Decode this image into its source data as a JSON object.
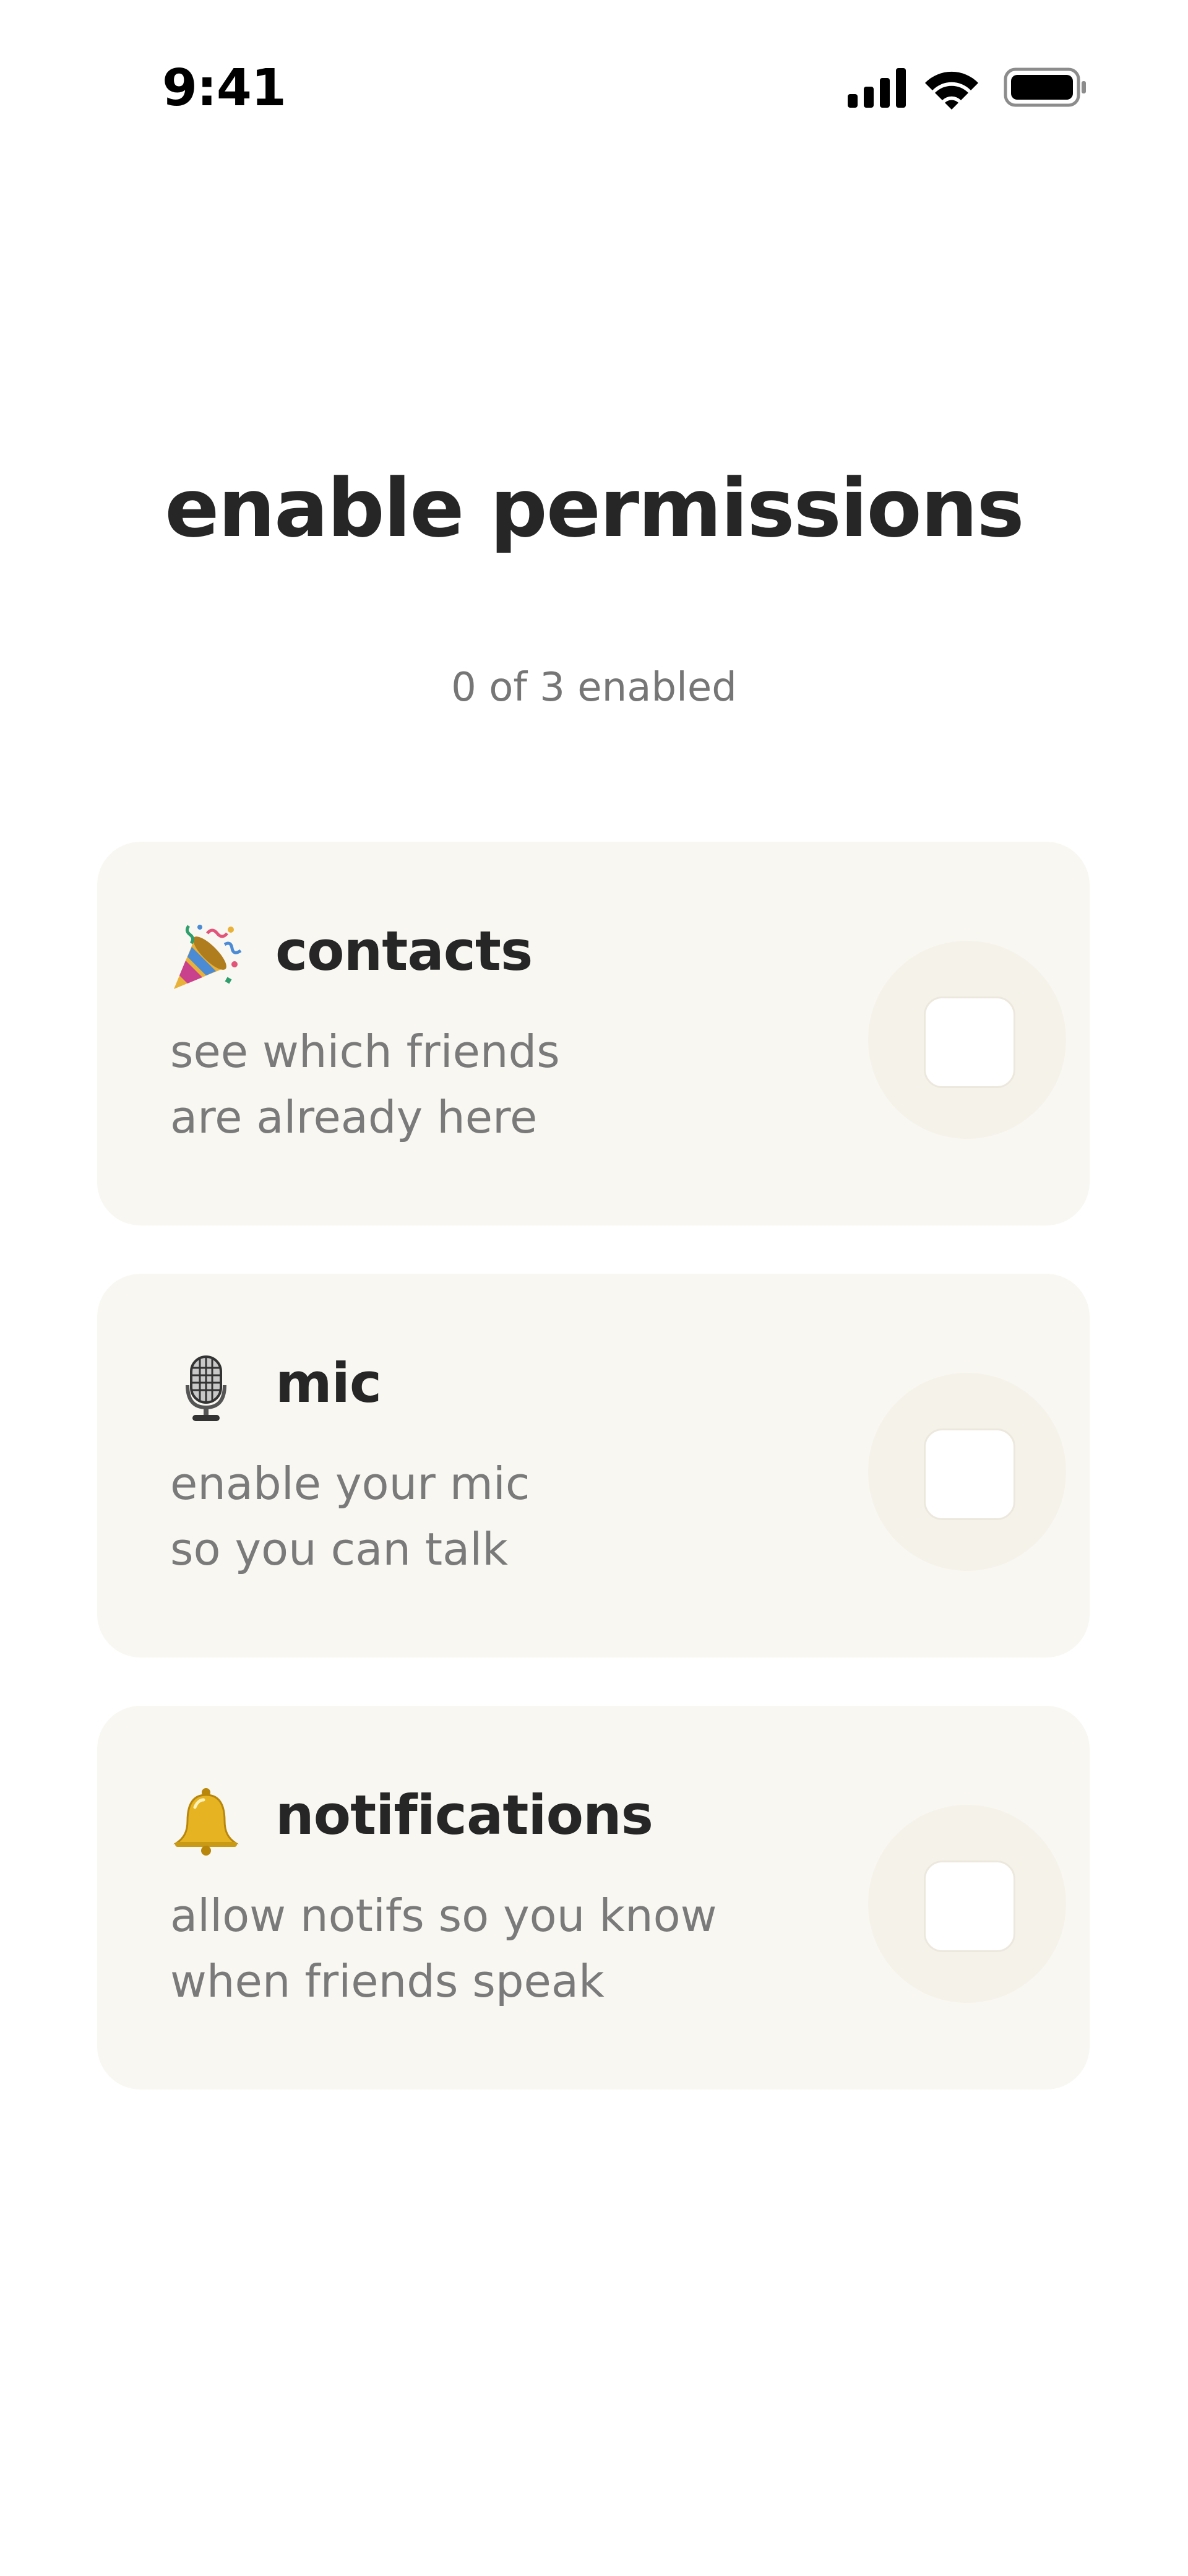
{
  "status_bar": {
    "time": "9:41",
    "icons": [
      "cellular-signal-icon",
      "wifi-icon",
      "battery-icon"
    ]
  },
  "header": {
    "title": "enable permissions",
    "subtitle": "0 of 3 enabled"
  },
  "permissions": [
    {
      "id": "contacts",
      "icon": "party-popper-icon",
      "title": "contacts",
      "description_lines": [
        "see which friends",
        "are already here"
      ],
      "enabled": false
    },
    {
      "id": "mic",
      "icon": "microphone-icon",
      "title": "mic",
      "description_lines": [
        "enable your mic",
        "so you can talk"
      ],
      "enabled": false
    },
    {
      "id": "notifications",
      "icon": "bell-icon",
      "title": "notifications",
      "description_lines": [
        "allow notifs so you know",
        "when friends speak"
      ],
      "enabled": false
    }
  ],
  "colors": {
    "card_background": "#F9F7F1",
    "title_text": "#262626",
    "secondary_text": "#7A7A7A",
    "toggle_border": "#ECE8DE"
  }
}
